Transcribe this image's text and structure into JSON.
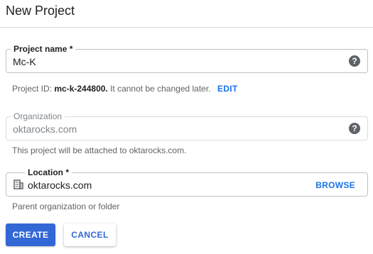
{
  "dialog": {
    "title": "New Project"
  },
  "project_name": {
    "label": "Project name *",
    "value": "Mc-K",
    "help_icon": "help-circle-icon"
  },
  "project_id": {
    "prefix": "Project ID: ",
    "id": "mc-k-244800.",
    "suffix": " It cannot be changed later.",
    "edit_label": "EDIT"
  },
  "organization": {
    "label": "Organization",
    "value": "oktarocks.com",
    "help_icon": "help-circle-icon",
    "hint": "This project will be attached to oktarocks.com."
  },
  "location": {
    "label": "Location *",
    "value": "oktarocks.com",
    "icon": "building-icon",
    "browse_label": "BROWSE",
    "hint": "Parent organization or folder"
  },
  "actions": {
    "create_label": "CREATE",
    "cancel_label": "CANCEL"
  },
  "colors": {
    "primary": "#3367d6",
    "link": "#1a73e8",
    "icon": "#5f6368",
    "border": "#bdc1c6"
  }
}
